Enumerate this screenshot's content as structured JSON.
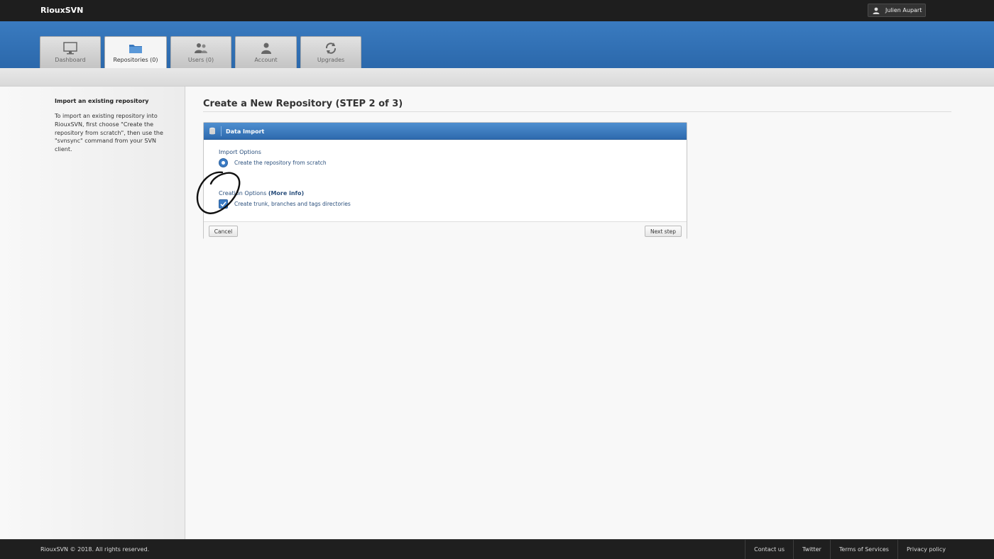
{
  "app": {
    "brand": "RiouxSVN"
  },
  "user": {
    "name": "Julien Aupart",
    "icon": "user-icon"
  },
  "tabs": [
    {
      "label": "Dashboard",
      "icon": "monitor-icon",
      "active": false
    },
    {
      "label": "Repositories (0)",
      "icon": "folder-icon",
      "active": true
    },
    {
      "label": "Users (0)",
      "icon": "users-icon",
      "active": false
    },
    {
      "label": "Account",
      "icon": "account-icon",
      "active": false
    },
    {
      "label": "Upgrades",
      "icon": "refresh-icon",
      "active": false
    }
  ],
  "sidebar": {
    "title": "Import an existing repository",
    "text": "To import an existing repository into RiouxSVN, first choose \"Create the repository from scratch\", then use the \"svnsync\" command from your SVN client."
  },
  "main": {
    "title": "Create a New Repository (STEP 2 of 3)",
    "panel": {
      "header": "Data Import",
      "header_icon": "database-icon",
      "import_options_label": "Import Options",
      "import_option": "Create the repository from scratch",
      "creation_options_label": "Creation Options",
      "more_info": "(More info)",
      "creation_option": "Create trunk, branches and tags directories",
      "creation_option_checked": true,
      "cancel_label": "Cancel",
      "next_label": "Next step"
    }
  },
  "footer": {
    "copyright": "RiouxSVN © 2018. All rights reserved.",
    "links": [
      "Contact us",
      "Twitter",
      "Terms of Services",
      "Privacy policy"
    ]
  },
  "colors": {
    "accent": "#2e6aae",
    "topbar": "#1e1e1e",
    "annotation": "#111111"
  }
}
